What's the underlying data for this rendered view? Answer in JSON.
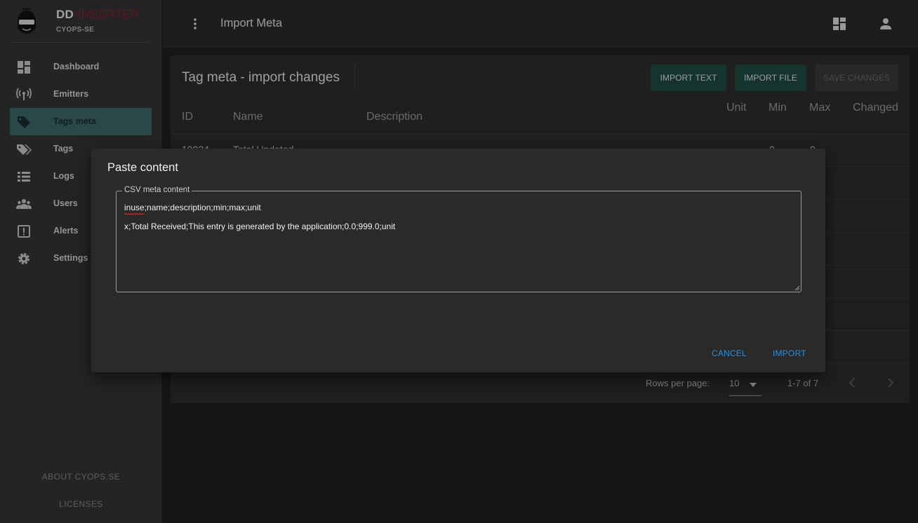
{
  "brand": {
    "name_dd": "DD",
    "name_inserter": "-INSERTER",
    "subtitle": "CYOPS-SE"
  },
  "sidebar": {
    "items": [
      {
        "label": "Dashboard",
        "icon": "dashboard-icon"
      },
      {
        "label": "Emitters",
        "icon": "broadcast-icon"
      },
      {
        "label": "Tags meta",
        "icon": "tag-icon",
        "active": true
      },
      {
        "label": "Tags",
        "icon": "tags-icon"
      },
      {
        "label": "Logs",
        "icon": "list-icon"
      },
      {
        "label": "Users",
        "icon": "users-icon"
      },
      {
        "label": "Alerts",
        "icon": "alert-icon"
      },
      {
        "label": "Settings",
        "icon": "gear-icon"
      }
    ],
    "footer": {
      "about": "ABOUT CYOPS.SE",
      "licenses": "LICENSES"
    }
  },
  "topbar": {
    "title": "Import Meta"
  },
  "card": {
    "title": "Tag meta - import changes",
    "buttons": {
      "import_text": "IMPORT TEXT",
      "import_file": "IMPORT FILE",
      "save_changes": "SAVE CHANGES"
    },
    "columns": {
      "id": "ID",
      "name": "Name",
      "description": "Description",
      "unit": "Unit",
      "min": "Min",
      "max": "Max",
      "changed": "Changed"
    },
    "partial_row": {
      "id": "10024",
      "name": "Total Updated",
      "min": "0",
      "max": "0"
    },
    "pagination": {
      "rows_label": "Rows per page:",
      "rows_value": "10",
      "range": "1-7 of 7"
    }
  },
  "dialog": {
    "title": "Paste content",
    "field_label": "CSV meta content",
    "lines": [
      "inuse;name;description;min;max;unit",
      "x;Total Received;This entry is generated by the application;0.0;999.0;unit"
    ],
    "cancel": "CANCEL",
    "import": "IMPORT"
  },
  "colors": {
    "accent": "#3e6b6e",
    "brand_red": "#8c1f2c",
    "button_teal": "#1f4d45",
    "link_blue": "#2e8ed8"
  }
}
